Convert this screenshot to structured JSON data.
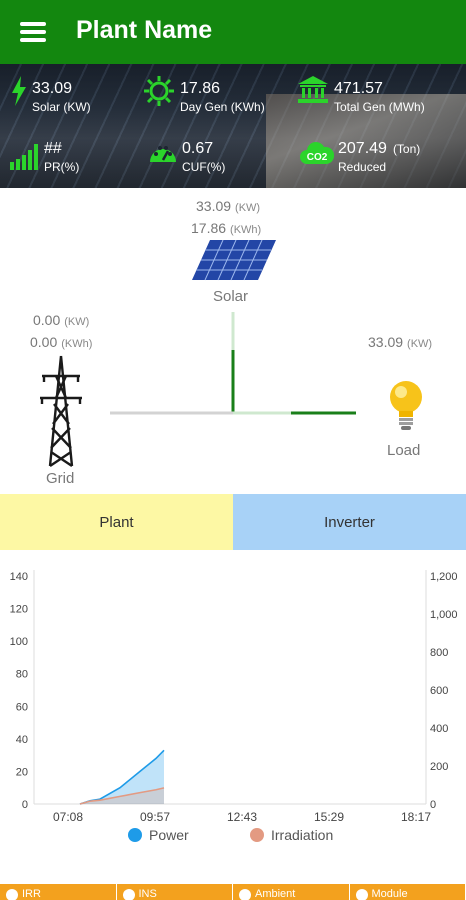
{
  "app": {
    "title": "Plant Name"
  },
  "stats": {
    "solar": {
      "value": "33.09",
      "label": "Solar (KW)"
    },
    "day_gen": {
      "value": "17.86",
      "label": "Day Gen (KWh)"
    },
    "total_gen": {
      "value": "471.57",
      "label": "Total Gen (MWh)"
    },
    "pr": {
      "value": "##",
      "label": "PR(%)"
    },
    "cuf": {
      "value": "0.67",
      "label": "CUF(%)"
    },
    "reduced": {
      "value": "207.49",
      "unit": "(Ton)",
      "label": "Reduced",
      "icon_text": "CO2"
    }
  },
  "flow": {
    "solar": {
      "power": "33.09",
      "power_unit": "(KW)",
      "energy": "17.86",
      "energy_unit": "(KWh)",
      "caption": "Solar"
    },
    "grid": {
      "power": "0.00",
      "power_unit": "(KW)",
      "energy": "0.00",
      "energy_unit": "(KWh)",
      "caption": "Grid"
    },
    "load": {
      "power": "33.09",
      "power_unit": "(KW)",
      "caption": "Load"
    }
  },
  "tabs": [
    {
      "label": "Plant",
      "color": "#fdf8a4"
    },
    {
      "label": "Inverter",
      "color": "#a8d2f7"
    }
  ],
  "chart_data": {
    "type": "area",
    "x_ticks": [
      "07:08",
      "09:57",
      "12:43",
      "15:29",
      "18:17"
    ],
    "y_left": {
      "ticks": [
        0,
        20,
        40,
        60,
        80,
        100,
        120,
        140
      ],
      "range": [
        0,
        140
      ]
    },
    "y_right": {
      "ticks": [
        "0",
        "200",
        "400",
        "600",
        "800",
        "1,000",
        "1,200"
      ],
      "range": [
        0,
        1200
      ]
    },
    "series": [
      {
        "name": "Power",
        "color": "#1e9be8",
        "axis": "left",
        "points": [
          [
            0.0,
            0
          ],
          [
            0.05,
            2
          ],
          [
            0.1,
            3
          ],
          [
            0.2,
            10
          ],
          [
            0.3,
            20
          ],
          [
            0.38,
            28
          ],
          [
            0.42,
            33
          ]
        ]
      },
      {
        "name": "Irradiation",
        "color": "#e39a82",
        "axis": "right",
        "points": [
          [
            0.0,
            0
          ],
          [
            0.05,
            15
          ],
          [
            0.1,
            20
          ],
          [
            0.2,
            40
          ],
          [
            0.3,
            60
          ],
          [
            0.38,
            75
          ],
          [
            0.42,
            85
          ]
        ]
      }
    ],
    "legend": "bottom"
  },
  "bottom_tabs": [
    {
      "label": "IRR",
      "icon": "sun-icon"
    },
    {
      "label": "INS",
      "icon": "ins-icon"
    },
    {
      "label": "Ambient",
      "icon": "thermometer-icon"
    },
    {
      "label": "Module",
      "icon": "module-icon"
    }
  ],
  "colors": {
    "primary_green": "#13870f",
    "accent_orange": "#f3a11e",
    "flow_green": "#1a7f1a"
  }
}
